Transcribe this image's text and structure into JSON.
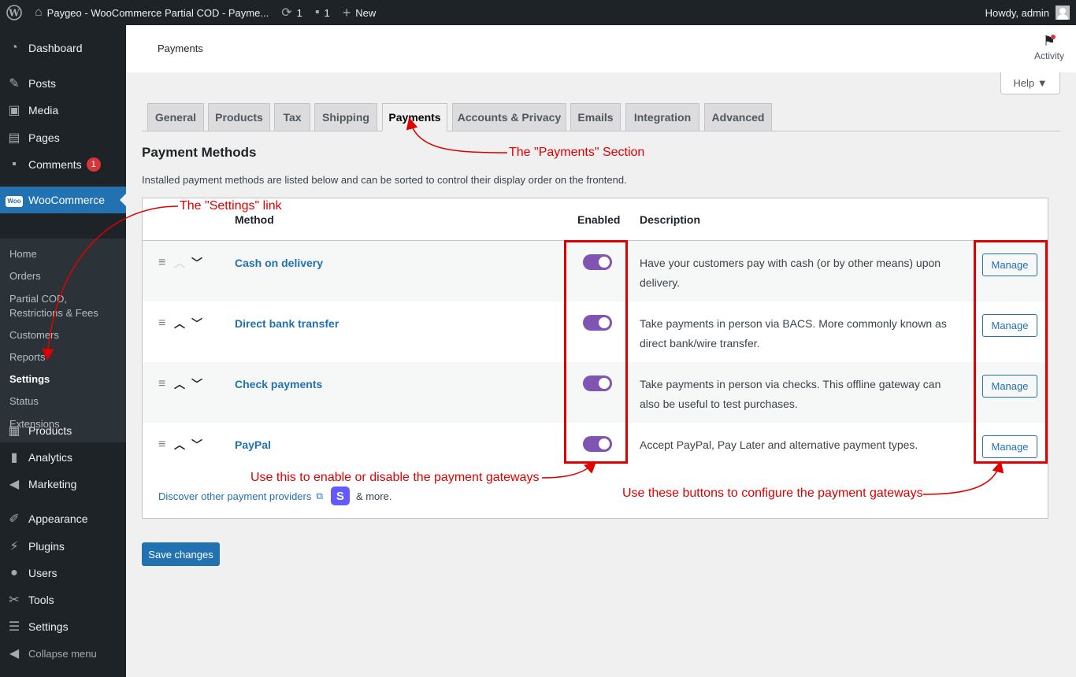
{
  "admin_bar": {
    "site_name": "Paygeo - WooCommerce Partial COD - Payme...",
    "updates_count": "1",
    "comments_count": "1",
    "new_label": "New",
    "howdy": "Howdy, admin"
  },
  "sidebar": {
    "items": [
      {
        "label": "Dashboard",
        "icon": "dashboard-icon"
      },
      {
        "label": "Posts",
        "icon": "pin-icon"
      },
      {
        "label": "Media",
        "icon": "media-icon"
      },
      {
        "label": "Pages",
        "icon": "pages-icon"
      },
      {
        "label": "Comments",
        "icon": "comment-icon",
        "badge": "1"
      },
      {
        "label": "WooCommerce",
        "icon": "woo-icon"
      },
      {
        "label": "Products",
        "icon": "archive-icon"
      },
      {
        "label": "Analytics",
        "icon": "bar-chart-icon"
      },
      {
        "label": "Marketing",
        "icon": "megaphone-icon"
      },
      {
        "label": "Appearance",
        "icon": "brush-icon"
      },
      {
        "label": "Plugins",
        "icon": "plug-icon"
      },
      {
        "label": "Users",
        "icon": "user-icon"
      },
      {
        "label": "Tools",
        "icon": "wrench-icon"
      },
      {
        "label": "Settings",
        "icon": "sliders-icon"
      },
      {
        "label": "Collapse menu",
        "icon": "collapse-icon"
      }
    ],
    "submenu": [
      {
        "label": "Home"
      },
      {
        "label": "Orders"
      },
      {
        "label": "Partial COD,\nRestrictions & Fees"
      },
      {
        "label": "Customers"
      },
      {
        "label": "Reports"
      },
      {
        "label": "Settings"
      },
      {
        "label": "Status"
      },
      {
        "label": "Extensions"
      }
    ]
  },
  "header": {
    "title": "Payments",
    "activity_label": "Activity",
    "help_label": "Help ▼"
  },
  "tabs": [
    "General",
    "Products",
    "Tax",
    "Shipping",
    "Payments",
    "Accounts & Privacy",
    "Emails",
    "Integration",
    "Advanced"
  ],
  "active_tab": "Payments",
  "main": {
    "section_title": "Payment Methods",
    "section_desc": "Installed payment methods are listed below and can be sorted to control their display order on the frontend.",
    "columns": {
      "method": "Method",
      "enabled": "Enabled",
      "description": "Description"
    },
    "gateways": [
      {
        "name": "Cash on delivery",
        "enabled": true,
        "description": "Have your customers pay with cash (or by other means) upon delivery.",
        "manage": "Manage"
      },
      {
        "name": "Direct bank transfer",
        "enabled": true,
        "description": "Take payments in person via BACS. More commonly known as direct bank/wire transfer.",
        "manage": "Manage"
      },
      {
        "name": "Check payments",
        "enabled": true,
        "description": "Take payments in person via checks. This offline gateway can also be useful to test purchases.",
        "manage": "Manage"
      },
      {
        "name": "PayPal",
        "enabled": true,
        "description": "Accept PayPal, Pay Later and alternative payment types.",
        "manage": "Manage"
      }
    ],
    "discover_label": "Discover other payment providers",
    "discover_more": "& more.",
    "stripe_letter": "S",
    "save_label": "Save changes"
  },
  "annotations": {
    "payments_section": "The \"Payments\" Section",
    "settings_link": "The \"Settings\" link",
    "toggle_note": "Use this to enable or disable the payment gateways",
    "manage_note": "Use these buttons to configure the payment gateways",
    "color": "#e00000"
  },
  "colors": {
    "accent": "#2271b1",
    "toggle_on": "#7f54b3",
    "admin_dark": "#1d2327",
    "badge": "#d63638"
  }
}
